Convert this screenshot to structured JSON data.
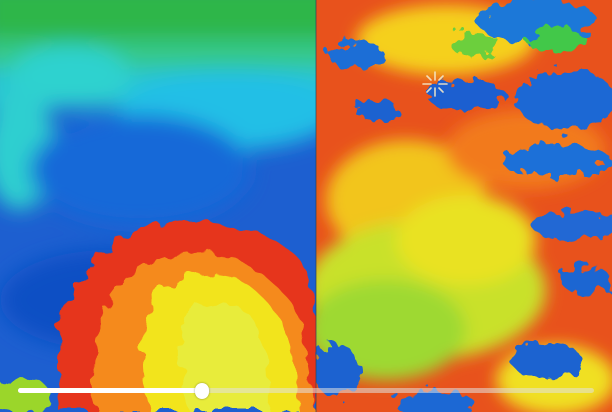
{
  "viewer": {
    "palette": [
      "#0b3fb8",
      "#1a6fd8",
      "#22b8e6",
      "#29d8c8",
      "#3cd05a",
      "#a5dc1e",
      "#f0e61e",
      "#f58f1e",
      "#e8321c"
    ],
    "left_panel": "temperature-map-before",
    "right_panel": "temperature-map-after"
  },
  "playback": {
    "progress": 0.32,
    "track_color": "#e1e1e1",
    "fill_color": "#ffffff"
  }
}
